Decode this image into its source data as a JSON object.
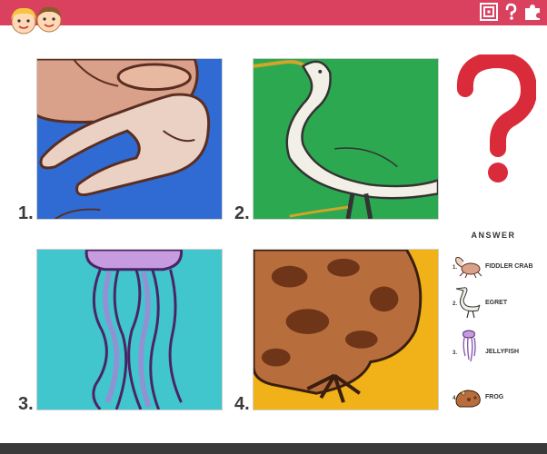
{
  "header": {
    "icons": [
      "kids-logo-icon",
      "spiral-icon",
      "question-icon",
      "puzzle-icon"
    ],
    "bar_color": "#d9415e"
  },
  "panels": [
    {
      "number": "1.",
      "subject": "crab-claw-image",
      "bg": "#2f6bd3"
    },
    {
      "number": "2.",
      "subject": "egret-image",
      "bg": "#2ca850"
    },
    {
      "number": "3.",
      "subject": "jellyfish-image",
      "bg": "#41c6cd"
    },
    {
      "number": "4.",
      "subject": "frog-image",
      "bg": "#f0b218"
    }
  ],
  "question_mark_color": "#d92b3a",
  "answer": {
    "title": "ANSWER",
    "items": [
      {
        "num": "1.",
        "label": "FIDDLER CRAB"
      },
      {
        "num": "2.",
        "label": "EGRET"
      },
      {
        "num": "3.",
        "label": "JELLYFISH"
      },
      {
        "num": "4.",
        "label": "FROG"
      }
    ]
  }
}
